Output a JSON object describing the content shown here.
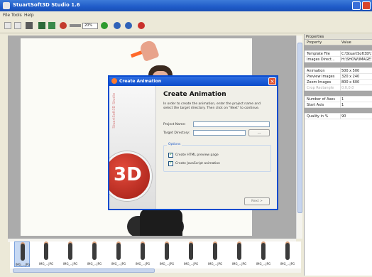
{
  "window": {
    "title": "StuartSoft3D Studio 1.6"
  },
  "menu": [
    "File",
    "Tools",
    "Help"
  ],
  "toolbar": {
    "zoom_value": "20%"
  },
  "properties": {
    "header": "Properties",
    "col_property": "Property",
    "col_value": "Value",
    "rows": [
      {
        "group": true,
        "key": "",
        "value": ""
      },
      {
        "key": "Template File",
        "value": "C:\\StuartSoft3D\\Studio\\Templates"
      },
      {
        "key": "Images Direct...",
        "value": "H:\\SHOW\\IMAGES"
      },
      {
        "group": true,
        "key": "",
        "value": ""
      },
      {
        "key": "Animation",
        "value": "500 x 500"
      },
      {
        "key": "Preview Images",
        "value": "320 x 240"
      },
      {
        "key": "Zoom Images",
        "value": "800 x 600"
      },
      {
        "key": "Crop Rectangle",
        "value": "0,0,0,0",
        "faded": true
      },
      {
        "group": true,
        "key": "",
        "value": ""
      },
      {
        "key": "Number of Axes",
        "value": "1"
      },
      {
        "key": "Start Axis",
        "value": "1"
      },
      {
        "group": true,
        "key": "",
        "value": ""
      },
      {
        "key": "Quality in %",
        "value": "90"
      }
    ]
  },
  "filmstrip": {
    "items": [
      {
        "caption": "IMG_...JPG"
      },
      {
        "caption": "IMG_...JPG"
      },
      {
        "caption": "IMG_...JPG"
      },
      {
        "caption": "IMG_...JPG"
      },
      {
        "caption": "IMG_...JPG"
      },
      {
        "caption": "IMG_...JPG"
      },
      {
        "caption": "IMG_...JPG"
      },
      {
        "caption": "IMG_...JPG"
      },
      {
        "caption": "IMG_...JPG"
      },
      {
        "caption": "IMG_...JPG"
      },
      {
        "caption": "IMG_...JPG"
      },
      {
        "caption": "IMG_...JPG"
      }
    ]
  },
  "dialog": {
    "title": "Create Animation",
    "heading": "Create Animation",
    "description": "In order to create the animation, enter the project name and select the target directory. Then click on \"Next\" to continue.",
    "side_brand": "StuartSoft3D Studio",
    "logo_text": "3D",
    "project_name_label": "Project Name:",
    "target_dir_label": "Target Directory:",
    "browse_label": "...",
    "options_legend": "Options",
    "opt_html": "Create HTML preview page",
    "opt_js": "Create JavaScript animation",
    "next_label": "Next >"
  }
}
